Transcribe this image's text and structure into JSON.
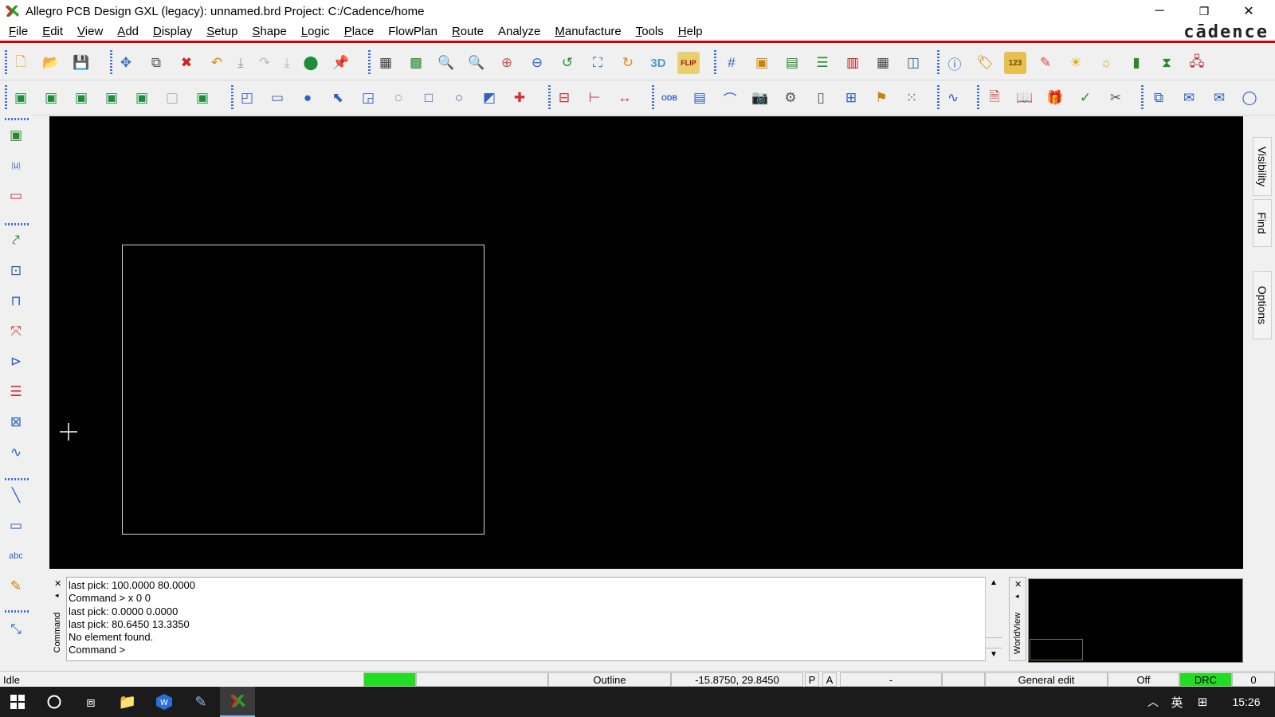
{
  "window": {
    "title": "Allegro PCB Design GXL (legacy): unnamed.brd  Project: C:/Cadence/home",
    "minimize": "─",
    "restore": "❐",
    "close": "✕"
  },
  "menubar": {
    "items": [
      {
        "u": "F",
        "rest": "ile"
      },
      {
        "u": "E",
        "rest": "dit"
      },
      {
        "u": "V",
        "rest": "iew"
      },
      {
        "u": "A",
        "rest": "dd"
      },
      {
        "u": "D",
        "rest": "isplay"
      },
      {
        "u": "S",
        "rest": "etup"
      },
      {
        "u": "S",
        "rest": "hape"
      },
      {
        "u": "L",
        "rest": "ogic"
      },
      {
        "u": "P",
        "rest": "lace"
      },
      {
        "u": "",
        "rest": "FlowPlan"
      },
      {
        "u": "R",
        "rest": "oute"
      },
      {
        "u": "",
        "rest": "Analyze"
      },
      {
        "u": "M",
        "rest": "anufacture"
      },
      {
        "u": "T",
        "rest": "ools"
      },
      {
        "u": "H",
        "rest": "elp"
      }
    ],
    "brand": "cādence"
  },
  "side_tabs": {
    "visibility": "Visibility",
    "find": "Find",
    "options": "Options"
  },
  "command": {
    "label": "Command",
    "lines": [
      "last pick:  100.0000 80.0000",
      "Command > x 0 0",
      "last pick:  0.0000 0.0000",
      "last pick:  80.6450 13.3350",
      "No element found.",
      "Command >"
    ]
  },
  "worldview": {
    "label": "WorldView"
  },
  "toolbar_text": {
    "three_d": "3D",
    "flip": "FLIP",
    "count": "123",
    "odb": "ODB",
    "abc": "abc"
  },
  "statusbar": {
    "state": "Idle",
    "active_class": "Outline",
    "coordinates": "-15.8750, 29.8450",
    "p_button": "P",
    "a_button": "A",
    "dash": "-",
    "mode": "General edit",
    "off": "Off",
    "drc": "DRC",
    "drc_count": "0",
    "ready_color": "#22dd22"
  },
  "taskbar": {
    "ime": "英",
    "time": "15:26"
  }
}
